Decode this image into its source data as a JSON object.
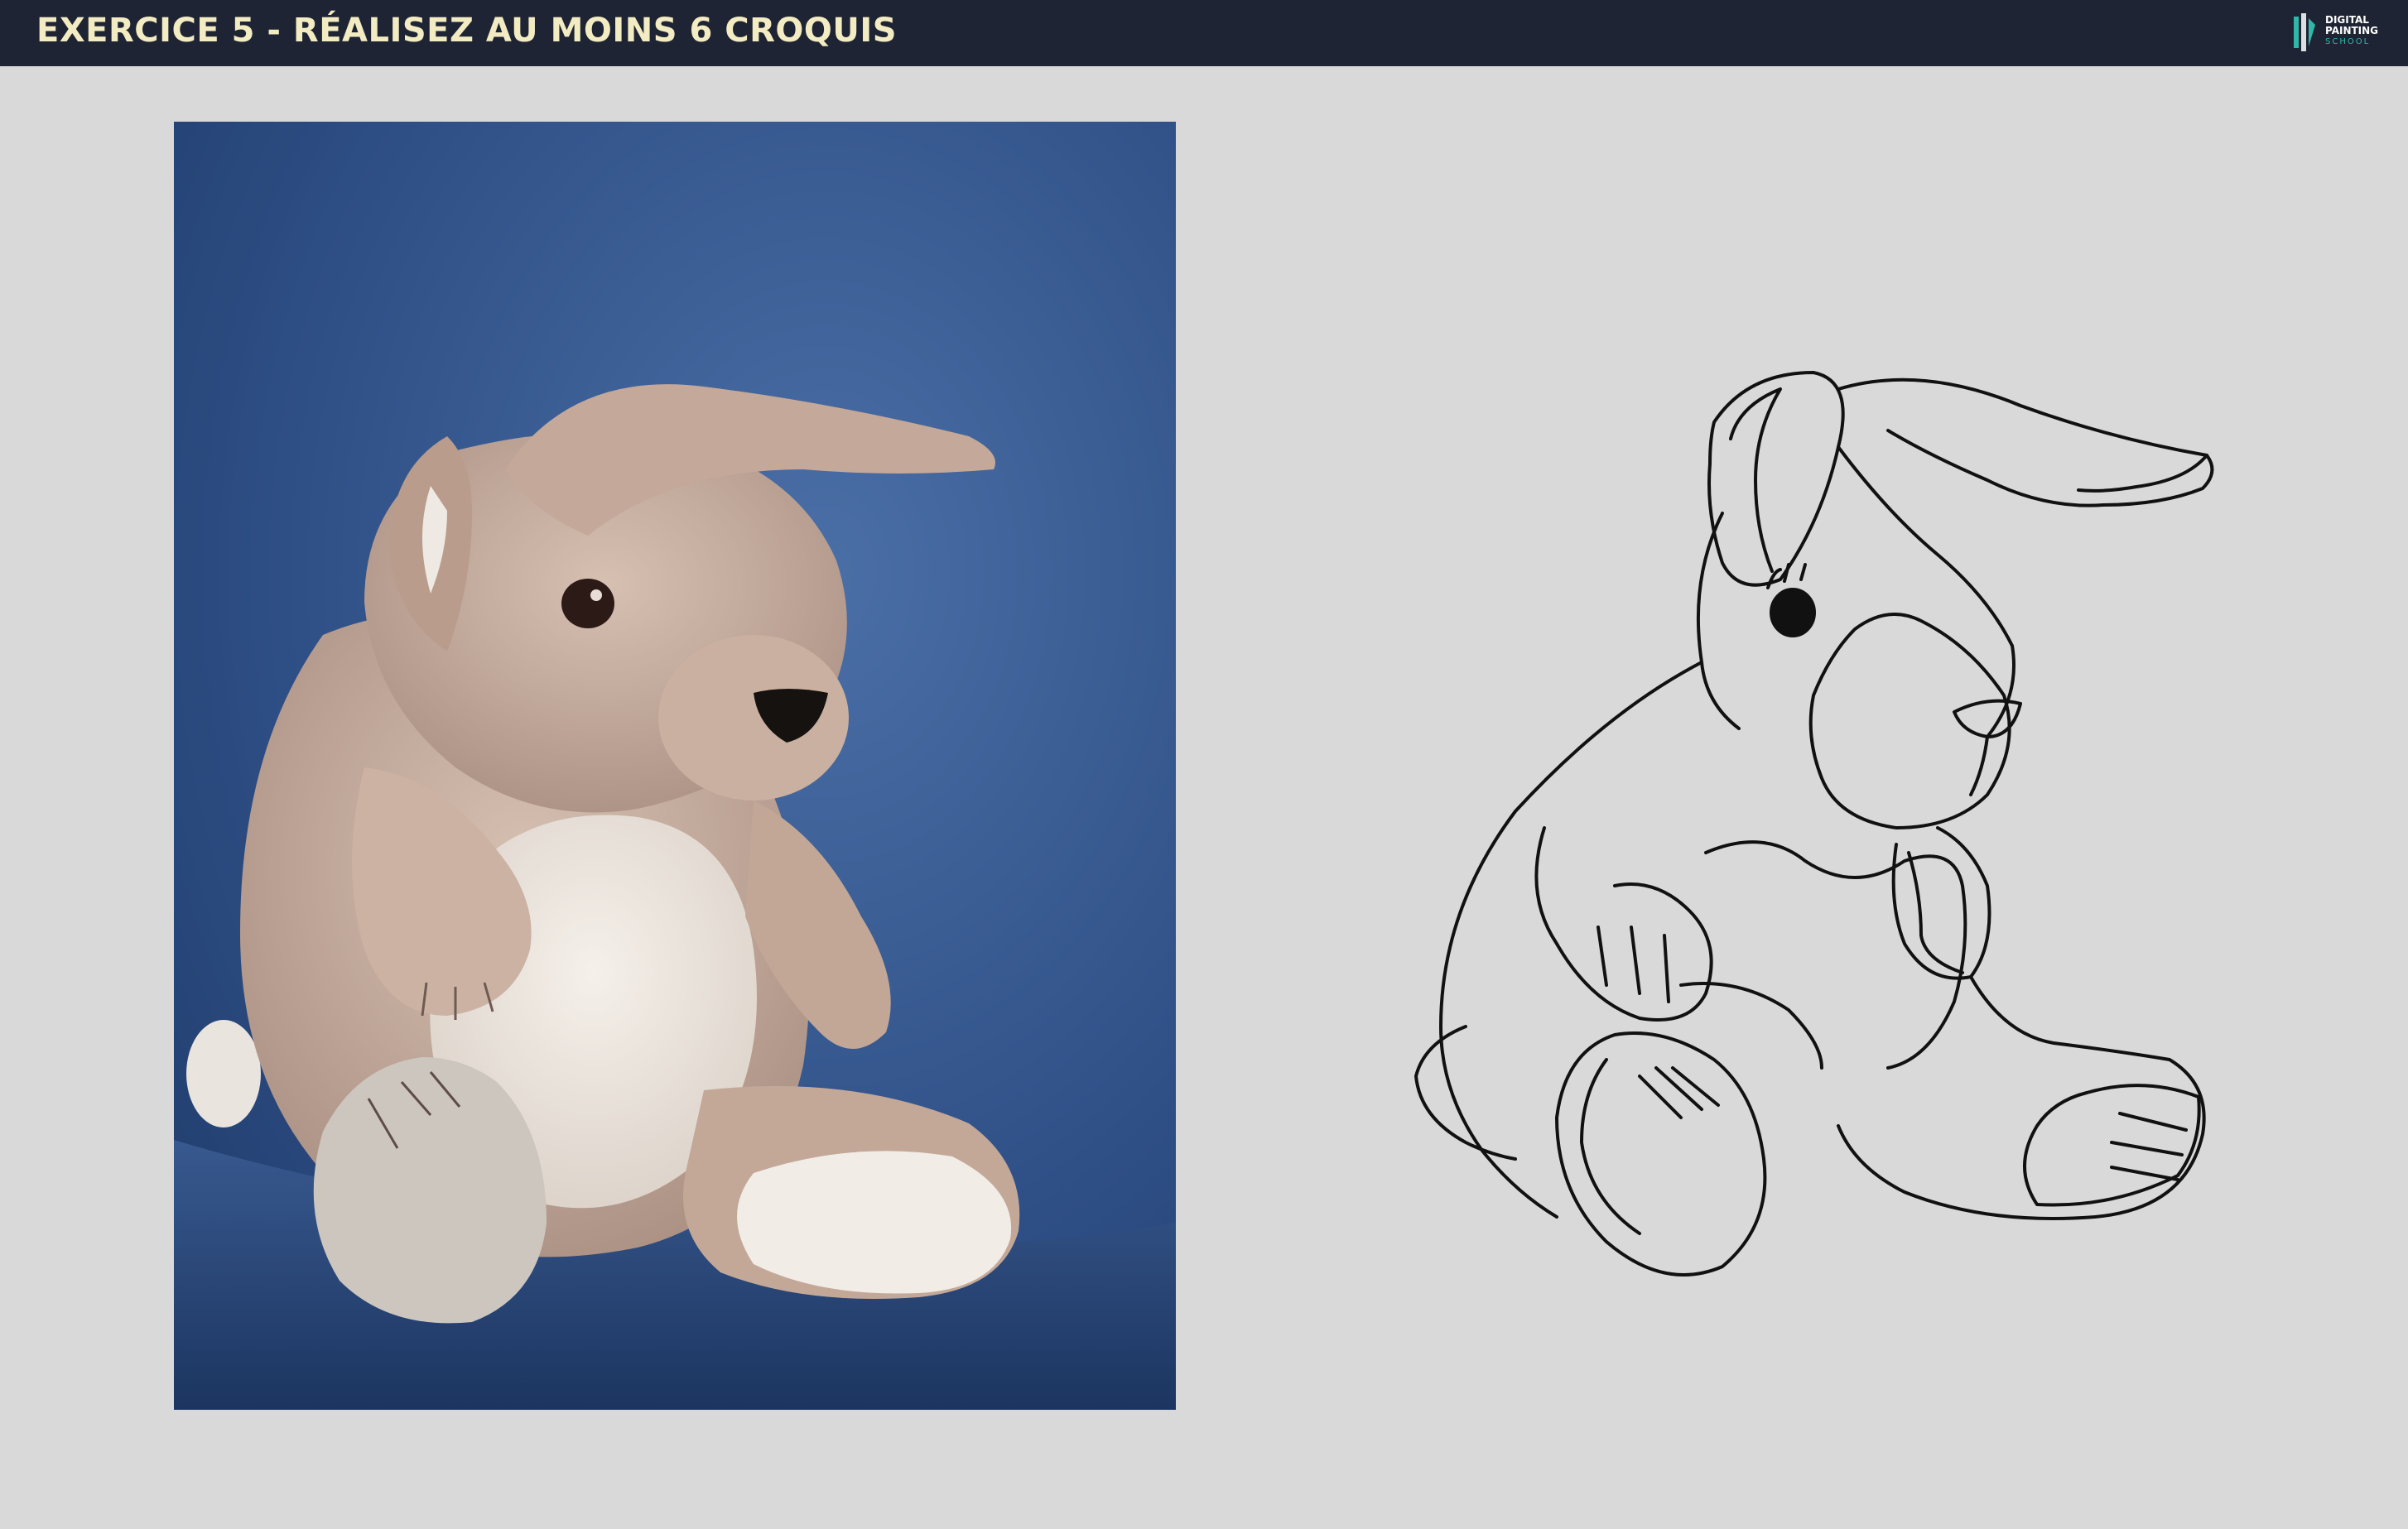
{
  "header": {
    "title": "EXERCICE 5 - RÉALISEZ AU MOINS 6 CROQUIS",
    "logo": {
      "line1": "DIGITAL",
      "line2": "PAINTING",
      "line3": "SCHOOL",
      "icon": "paintbrush-logo-icon"
    }
  },
  "colors": {
    "header_bg": "#1e2433",
    "title_color": "#f3ecc2",
    "page_bg": "#d9d9d9",
    "photo_bg": "#2e4f86",
    "plush_body": "#c7ad9e",
    "plush_belly": "#eae3dc",
    "logo_accent": "#2fb8a8"
  },
  "content": {
    "photo_subject": "plush-rabbit-photo",
    "sketch_subject": "plush-rabbit-line-sketch"
  }
}
